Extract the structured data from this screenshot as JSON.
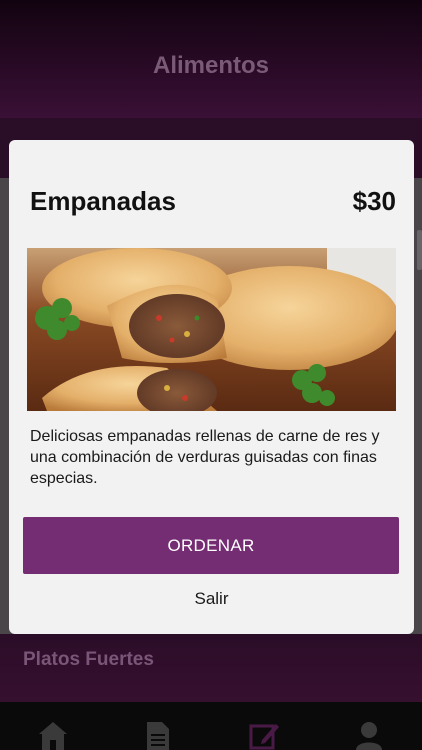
{
  "header": {
    "title": "Alimentos"
  },
  "background": {
    "section_label": "Platos Fuertes"
  },
  "modal": {
    "title": "Empanadas",
    "price": "$30",
    "image_icon": "empanadas-photo",
    "description": "Deliciosas empanadas rellenas de carne de res y una combinación de verduras guisadas con finas especias.",
    "order_label": "ORDENAR",
    "exit_label": "Salir"
  },
  "tabbar": {
    "items": [
      {
        "icon": "home-icon"
      },
      {
        "icon": "document-icon"
      },
      {
        "icon": "edit-icon"
      },
      {
        "icon": "user-icon"
      }
    ]
  },
  "colors": {
    "accent": "#742c73",
    "header_bg": "#2a0a27",
    "modal_bg": "#f2f2f2"
  }
}
